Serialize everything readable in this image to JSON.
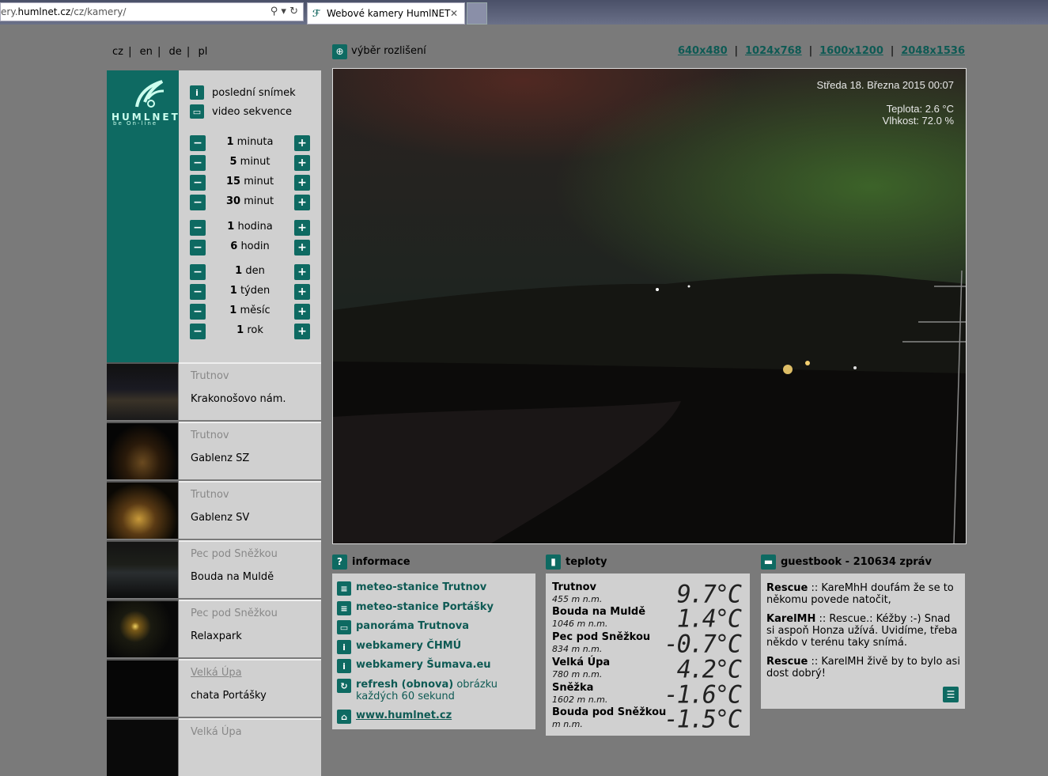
{
  "browser": {
    "address_prefix": "ery.",
    "address_domain": "humlnet.cz",
    "address_path": "/cz/kamery/",
    "tab_title": "Webové kamery HumlNET",
    "tab_close": "✕",
    "search_icon": "⚲",
    "refresh_icon": "↻"
  },
  "languages": [
    "cz",
    "en",
    "de",
    "pl"
  ],
  "logo": {
    "text": "HUMLNET",
    "sub": "be On-line"
  },
  "menu": {
    "last_snapshot": "poslední snímek",
    "video": "video sekvence"
  },
  "time_steps": [
    {
      "num": "1",
      "unit": "minuta"
    },
    {
      "num": "5",
      "unit": "minut"
    },
    {
      "num": "15",
      "unit": "minut"
    },
    {
      "num": "30",
      "unit": "minut"
    },
    {
      "num": "1",
      "unit": "hodina"
    },
    {
      "num": "6",
      "unit": "hodin"
    },
    {
      "num": "1",
      "unit": "den"
    },
    {
      "num": "1",
      "unit": "týden"
    },
    {
      "num": "1",
      "unit": "měsíc"
    },
    {
      "num": "1",
      "unit": "rok"
    }
  ],
  "cameras": [
    {
      "location": "Trutnov",
      "name": "Krakonošovo nám."
    },
    {
      "location": "Trutnov",
      "name": "Gablenz SZ"
    },
    {
      "location": "Trutnov",
      "name": "Gablenz SV"
    },
    {
      "location": "Pec pod Sněžkou",
      "name": "Bouda na Muldě"
    },
    {
      "location": "Pec pod Sněžkou",
      "name": "Relaxpark"
    },
    {
      "location": "Velká Úpa",
      "name": "chata Portášky"
    },
    {
      "location": "Velká Úpa",
      "name": ""
    }
  ],
  "resolution": {
    "title": "výběr rozlišení",
    "options": [
      "640x480",
      "1024x768",
      "1600x1200",
      "2048x1536"
    ],
    "separator": "|"
  },
  "image_overlay": {
    "datetime": "Středa   18. Března 2015  00:07",
    "temp": "Teplota: 2.6 °C",
    "humidity": "Vlhkost: 72.0 %"
  },
  "info": {
    "title": "informace",
    "links": [
      {
        "text": "meteo-stanice Trutnov",
        "icon": "meteo-icon"
      },
      {
        "text": "meteo-stanice Portášky",
        "icon": "meteo-icon"
      },
      {
        "text": "panoráma Trutnova",
        "icon": "panorama-icon"
      },
      {
        "text": "webkamery ČHMÚ",
        "icon": "info-icon"
      },
      {
        "text": "webkamery Šumava.eu",
        "icon": "info-icon"
      }
    ],
    "refresh_bold": "refresh (obnova)",
    "refresh_rest": " obrázku",
    "refresh_line2": "každých 60 sekund",
    "home": "www.humlnet.cz"
  },
  "temps": {
    "title": "teploty",
    "rows": [
      {
        "station": "Trutnov",
        "alt": "455 m n.m.",
        "value": "9.7°C"
      },
      {
        "station": "Bouda na Muldě",
        "alt": "1046 m n.m.",
        "value": "1.4°C"
      },
      {
        "station": "Pec pod Sněžkou",
        "alt": "834 m n.m.",
        "value": "-0.7°C"
      },
      {
        "station": "Velká Úpa",
        "alt": "780 m n.m.",
        "value": "4.2°C"
      },
      {
        "station": "Sněžka",
        "alt": "1602 m n.m.",
        "value": "-1.6°C"
      },
      {
        "station": "Bouda pod Sněžkou",
        "alt": "m n.m.",
        "value": "-1.5°C"
      }
    ]
  },
  "guestbook": {
    "title": "guestbook - 210634 zpráv",
    "entries": [
      {
        "author": "Rescue",
        "sep": " :: ",
        "text": "KareMhH doufám že se to někomu povede natočit,"
      },
      {
        "author": "KarelMH",
        "sep": " :: ",
        "text": "Rescue.: Kéžby :-) Snad si aspoň Honza užívá. Uvidíme, třeba někdo v terénu taky snímá."
      },
      {
        "author": "Rescue",
        "sep": " :: ",
        "text": "KarelMH živě by to bylo asi dost dobrý!"
      }
    ]
  },
  "colors": {
    "accent": "#0e6a62",
    "panel": "#d0d0d0",
    "background": "#7a7a7a"
  }
}
